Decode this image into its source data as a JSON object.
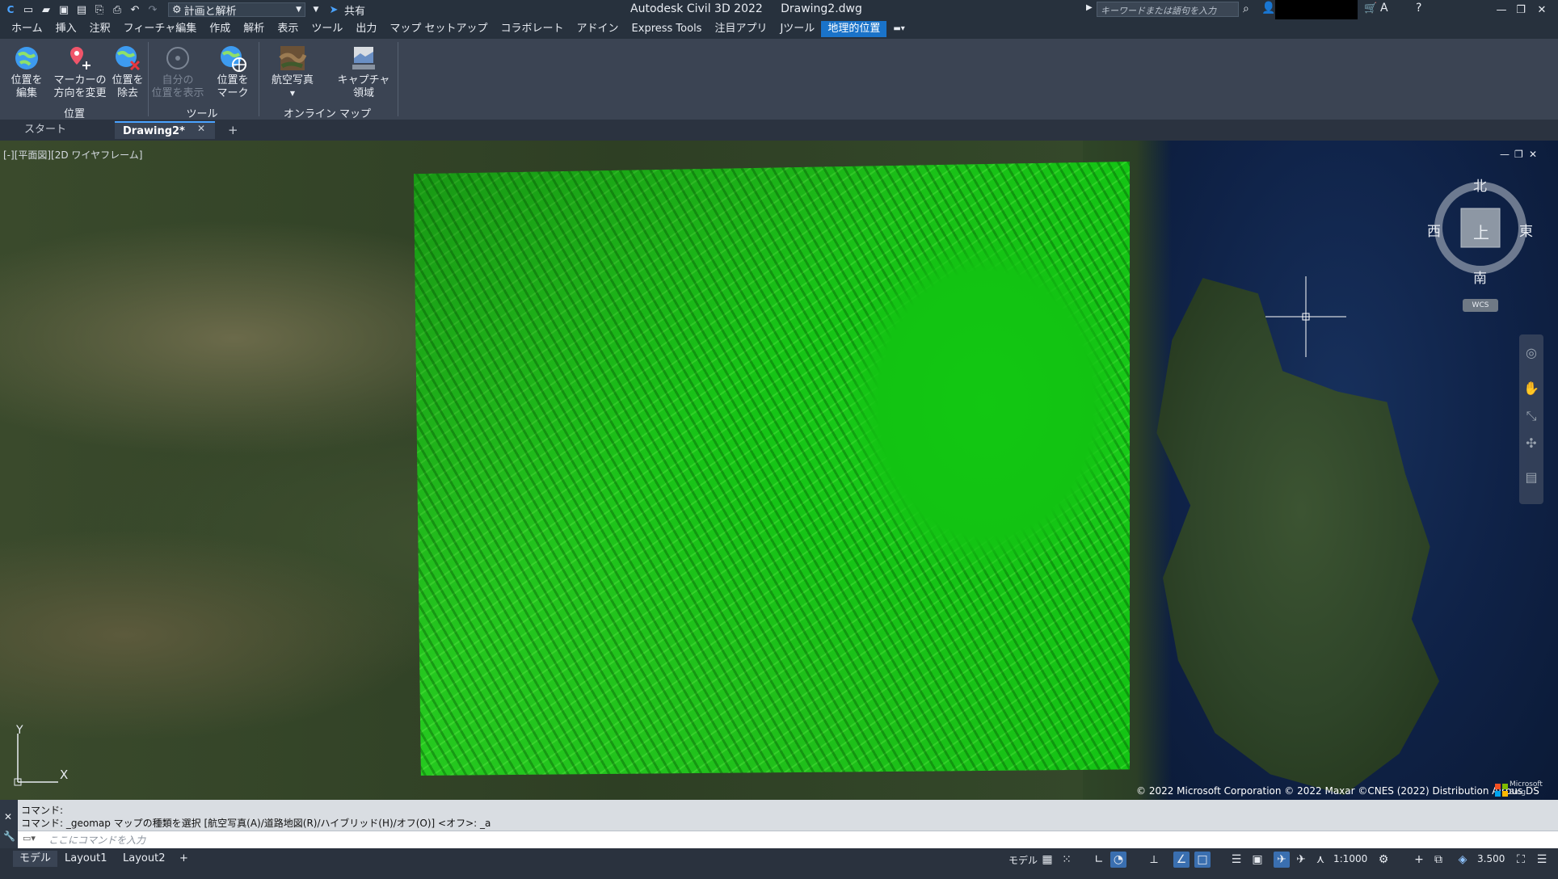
{
  "titlebar": {
    "workspace": "計画と解析",
    "share": "共有",
    "app_title": "Autodesk Civil 3D 2022",
    "file_name": "Drawing2.dwg",
    "search_placeholder": "キーワードまたは語句を入力"
  },
  "menu": {
    "tabs": [
      "ホーム",
      "挿入",
      "注釈",
      "フィーチャ編集",
      "作成",
      "解析",
      "表示",
      "ツール",
      "出力",
      "マップ セットアップ",
      "コラボレート",
      "アドイン",
      "Express Tools",
      "注目アプリ",
      "Jツール",
      "地理的位置"
    ],
    "active": "地理的位置"
  },
  "ribbon": {
    "btn_edit_location": "位置を\n編集",
    "btn_marker_dir": "マーカーの\n方向を変更",
    "btn_remove_location": "位置を\n除去",
    "panel_location": "位置",
    "btn_show_my_location": "自分の\n位置を表示",
    "btn_mark_location": "位置を\nマーク",
    "panel_tools": "ツール",
    "btn_aerial": "航空写真",
    "btn_capture": "キャプチャ\n領域",
    "panel_online_map": "オンライン マップ"
  },
  "doctabs": {
    "start": "スタート",
    "drawing": "Drawing2*",
    "new": "+"
  },
  "viewport": {
    "label": "[-][平面図][2D ワイヤフレーム]",
    "copyright": "© 2022 Microsoft Corporation © 2022 Maxar ©CNES (2022) Distribution Airbus DS",
    "ms_logo_text": "Microsoft Bing",
    "viewcube": {
      "north": "北",
      "south": "南",
      "east": "東",
      "west": "西",
      "top": "上",
      "wcs": "WCS"
    },
    "ucs_x": "X",
    "ucs_y": "Y"
  },
  "command": {
    "line1": "コマンド:",
    "line2": "コマンド:  _geomap マップの種類を選択 [航空写真(A)/道路地図(R)/ハイブリッド(H)/オフ(O)] <オフ>: _a",
    "placeholder": "ここにコマンドを入力"
  },
  "statusbar": {
    "layouts": [
      "モデル",
      "Layout1",
      "Layout2"
    ],
    "add": "+",
    "model_btn": "モデル",
    "scale": "1:1000",
    "coord": "3.500"
  },
  "colors": {
    "accent": "#1a73c9",
    "ribbon_bg": "#3b4453",
    "titlebar_bg": "#27313d",
    "terrain_green": "#1fbf1a"
  }
}
